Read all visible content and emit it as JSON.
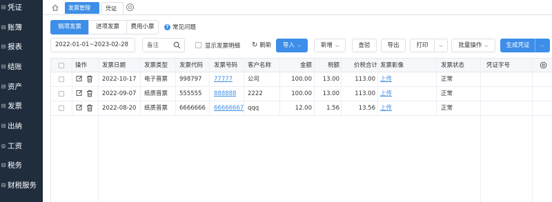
{
  "sidebar": {
    "items": [
      {
        "label": "凭证",
        "icon": "voucher-icon"
      },
      {
        "label": "账簿",
        "icon": "ledger-icon"
      },
      {
        "label": "报表",
        "icon": "report-icon"
      },
      {
        "label": "结账",
        "icon": "closing-icon"
      },
      {
        "label": "资产",
        "icon": "asset-icon"
      },
      {
        "label": "发票",
        "icon": "invoice-icon"
      },
      {
        "label": "出纳",
        "icon": "cashier-icon"
      },
      {
        "label": "工资",
        "icon": "salary-icon"
      },
      {
        "label": "税务",
        "icon": "tax-icon"
      },
      {
        "label": "财税服务",
        "icon": "finance-service-icon"
      }
    ]
  },
  "tabs": {
    "home_icon": "home-icon",
    "items": [
      {
        "label": "发票管理",
        "active": true
      },
      {
        "label": "凭证",
        "active": false
      }
    ]
  },
  "segment_tabs": [
    "销项发票",
    "进项发票",
    "费用小票"
  ],
  "faq": {
    "label": "常见问题",
    "icon": "question-icon"
  },
  "toolbar": {
    "date_range": "2022-01-01~2023-02-28",
    "search_placeholder": "备注",
    "show_detail_label": "显示发票明细",
    "refresh_label": "刷新",
    "import_label": "导入",
    "add_label": "新增",
    "verify_label": "查验",
    "export_label": "导出",
    "print_label": "打印",
    "batch_label": "批量操作",
    "generate_voucher_label": "生成凭证"
  },
  "table": {
    "headers": [
      "操作",
      "发票日期",
      "发票类型",
      "发票代码",
      "发票号码",
      "客户名称",
      "金额",
      "税额",
      "价税合计",
      "发票影像",
      "发票状态",
      "凭证字号"
    ],
    "rows": [
      {
        "date": "2022-10-17",
        "type": "电子普票",
        "code": "998797",
        "number": "77777",
        "customer": "公司",
        "amount": "100.00",
        "tax": "13.00",
        "total": "113.00",
        "image": "上传",
        "status": "正常",
        "voucher": ""
      },
      {
        "date": "2022-09-07",
        "type": "纸质普票",
        "code": "555555",
        "number": "888888",
        "customer": "2222",
        "amount": "100.00",
        "tax": "13.00",
        "total": "113.00",
        "image": "上传",
        "status": "正常",
        "voucher": ""
      },
      {
        "date": "2022-08-20",
        "type": "纸质普票",
        "code": "6666666",
        "number": "66666667",
        "customer": "qqq",
        "amount": "12.00",
        "tax": "1.56",
        "total": "13.56",
        "image": "上传",
        "status": "正常",
        "voucher": ""
      }
    ]
  },
  "colors": {
    "sidebar_bg": "#1f2d3d",
    "primary": "#3d8ee8",
    "link": "#3d8ee8"
  }
}
